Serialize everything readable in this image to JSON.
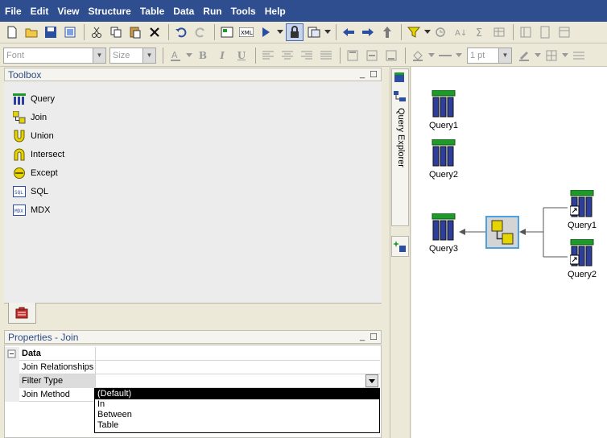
{
  "menubar": {
    "items": [
      "File",
      "Edit",
      "View",
      "Structure",
      "Table",
      "Data",
      "Run",
      "Tools",
      "Help"
    ]
  },
  "format_toolbar": {
    "font_placeholder": "Font",
    "size_placeholder": "Size",
    "line_width": "1 pt"
  },
  "toolbox": {
    "title": "Toolbox",
    "items": [
      {
        "label": "Query",
        "icon": "query-icon"
      },
      {
        "label": "Join",
        "icon": "join-icon"
      },
      {
        "label": "Union",
        "icon": "union-icon"
      },
      {
        "label": "Intersect",
        "icon": "intersect-icon"
      },
      {
        "label": "Except",
        "icon": "except-icon"
      },
      {
        "label": "SQL",
        "icon": "sql-icon"
      },
      {
        "label": "MDX",
        "icon": "mdx-icon"
      }
    ],
    "icon_text": {
      "sql": "SQL",
      "mdx": "MDX"
    }
  },
  "properties": {
    "title": "Properties -  Join",
    "section": "Data",
    "rows": [
      {
        "name": "Join Relationships",
        "value": ""
      },
      {
        "name": "Filter Type",
        "value": ""
      },
      {
        "name": "Join Method",
        "value": ""
      }
    ],
    "dropdown_options": [
      "(Default)",
      "In",
      "Between",
      "Table"
    ],
    "selected_option": "(Default)"
  },
  "side_tabs": {
    "query_explorer": "Query Explorer"
  },
  "canvas": {
    "nodes": {
      "query1_top": "Query1",
      "query2_top": "Query2",
      "query3": "Query3",
      "query1_right": "Query1",
      "query2_right": "Query2"
    }
  },
  "colors": {
    "menubar_bg": "#2e4e8f",
    "accent_green": "#1f9a2a",
    "query_bar": "#2d3f9a",
    "join_yellow": "#e6d400"
  }
}
